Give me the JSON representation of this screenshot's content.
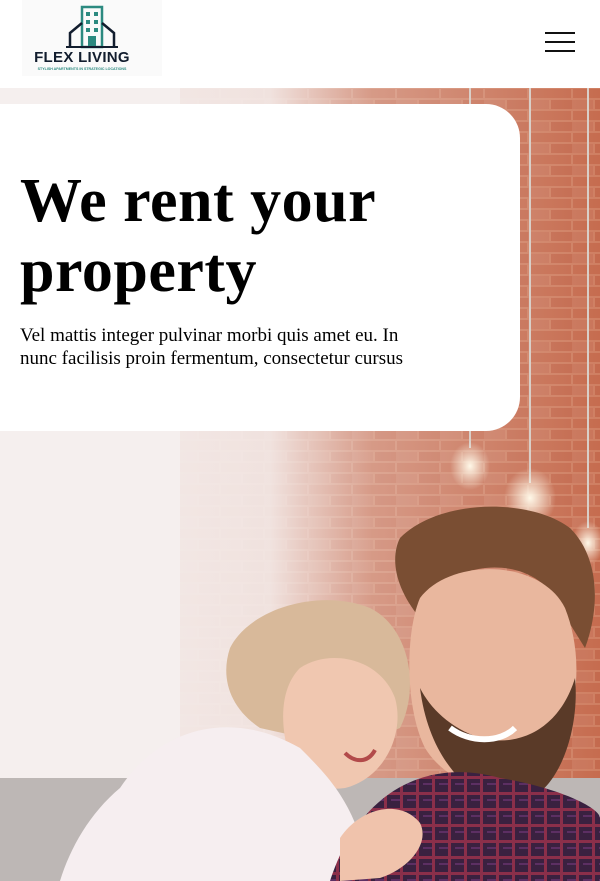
{
  "header": {
    "logo": {
      "name": "FLEX LIVING",
      "tagline": "STYLISH APARTMENTS IN STRATEGIC LOCATIONS",
      "icon": "building-icon",
      "colors": {
        "text": "#121d2e",
        "accent": "#2c8a80"
      }
    },
    "menu": {
      "icon": "hamburger-menu-icon"
    }
  },
  "hero": {
    "title": "We rent your property",
    "description": "Vel mattis integer pulvinar morbi quis amet eu. In nunc facilisis proin fermentum, consectetur cursus",
    "image": {
      "description_icon": "couple-photo",
      "colors": {
        "brick": "#c56a4e",
        "shirt": "#3e2340",
        "wall": "#f1ecea"
      }
    }
  }
}
